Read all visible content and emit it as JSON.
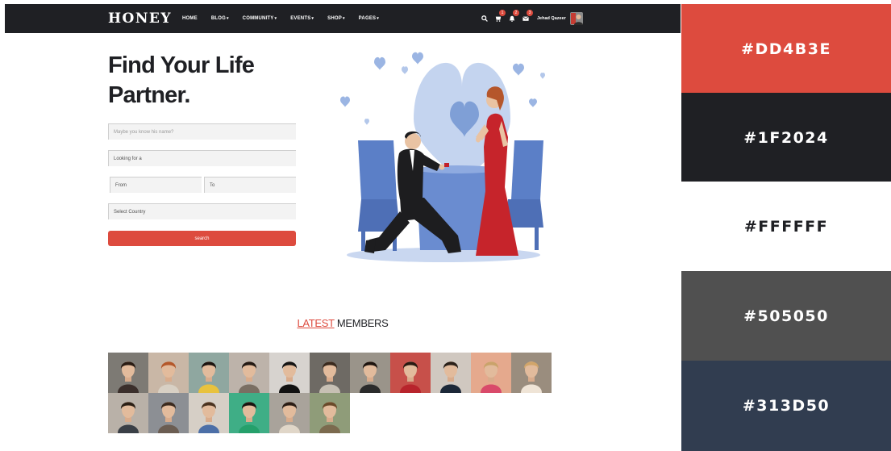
{
  "brand": "HONEY",
  "nav": {
    "items": [
      {
        "label": "HOME",
        "dropdown": false
      },
      {
        "label": "BLOG",
        "dropdown": true
      },
      {
        "label": "COMMUNITY",
        "dropdown": true
      },
      {
        "label": "EVENTS",
        "dropdown": true
      },
      {
        "label": "SHOP",
        "dropdown": true
      },
      {
        "label": "PAGES",
        "dropdown": true
      }
    ],
    "icons": [
      "search-icon",
      "cart-icon",
      "bell-icon",
      "mail-icon"
    ],
    "badges": {
      "cart": "1",
      "bell": "2",
      "mail": "3"
    },
    "username": "Jehad Qazeer"
  },
  "hero": {
    "title_line1": "Find Your Life",
    "title_line2": "Partner."
  },
  "form": {
    "name_placeholder": "Maybe you know his name?",
    "looking_for": "Looking for a",
    "from": "From",
    "to": "To",
    "country": "Select Country",
    "search_label": "search"
  },
  "members": {
    "heading_accent": "LATEST",
    "heading_rest": " MEMBERS",
    "count": 17
  },
  "palette": [
    {
      "hex": "#DD4B3E",
      "label": "#DD4B3E",
      "text_color": "#ffffff"
    },
    {
      "hex": "#1F2024",
      "label": "#1F2024",
      "text_color": "#ffffff"
    },
    {
      "hex": "#FFFFFF",
      "label": "#FFFFFF",
      "text_color": "#1F2024"
    },
    {
      "hex": "#505050",
      "label": "#505050",
      "text_color": "#ffffff"
    },
    {
      "hex": "#313D50",
      "label": "#313D50",
      "text_color": "#ffffff"
    }
  ]
}
